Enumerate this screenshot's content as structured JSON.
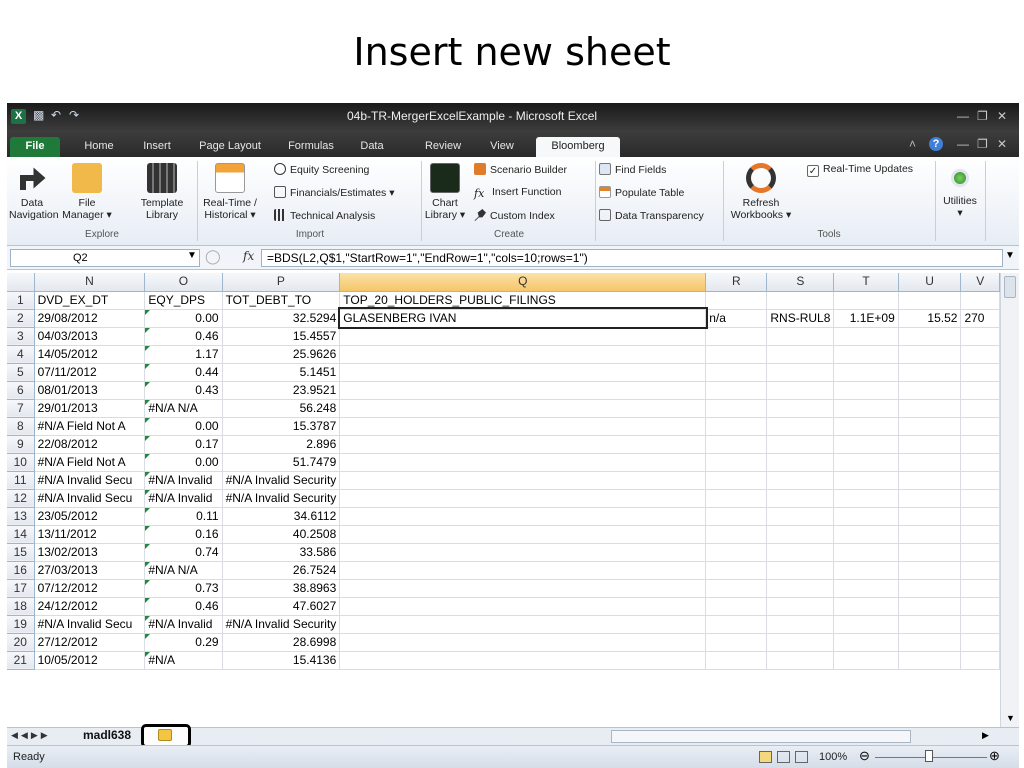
{
  "slide": {
    "title": "Insert new sheet"
  },
  "window": {
    "title": "04b-TR-MergerExcelExample  -  Microsoft Excel",
    "quick_access": [
      "save-icon",
      "undo-icon",
      "redo-icon"
    ]
  },
  "tabs": [
    "File",
    "Home",
    "Insert",
    "Page Layout",
    "Formulas",
    "Data",
    "Review",
    "View",
    "Bloomberg"
  ],
  "active_tab": "Bloomberg",
  "ribbon": {
    "data_navigation": [
      "Data",
      "Navigation"
    ],
    "file_manager": [
      "File",
      "Manager ▾"
    ],
    "template_library": [
      "Template",
      "Library"
    ],
    "explore_label": "Explore",
    "realtime_historical": [
      "Real-Time /",
      "Historical ▾"
    ],
    "equity_screening": "Equity Screening",
    "financials_estimates": "Financials/Estimates ▾",
    "technical_analysis": "Technical Analysis",
    "import_label": "Import",
    "chart_library": [
      "Chart",
      "Library ▾"
    ],
    "scenario_builder": "Scenario Builder",
    "insert_function": "Insert Function",
    "custom_index": "Custom Index",
    "create_label": "Create",
    "find_fields": "Find Fields",
    "populate_table": "Populate Table",
    "data_transparency": "Data Transparency",
    "refresh_workbooks": [
      "Refresh",
      "Workbooks ▾"
    ],
    "realtime_updates": "Real-Time Updates",
    "tools_label": "Tools",
    "utilities": "Utilities"
  },
  "formula_bar": {
    "name_box": "Q2",
    "fx": "fx",
    "formula": "=BDS(L2,Q$1,\"StartRow=1\",\"EndRow=1\",\"cols=10;rows=1\")"
  },
  "columns": [
    "N",
    "O",
    "P",
    "Q",
    "R",
    "S",
    "T",
    "U",
    "V"
  ],
  "rows": [
    {
      "r": "1",
      "N": "DVD_EX_DT",
      "O": "EQY_DPS",
      "P": "TOT_DEBT_TO",
      "Q": "TOP_20_HOLDERS_PUBLIC_FILINGS",
      "R": "",
      "S": "",
      "T": "",
      "U": "",
      "V": ""
    },
    {
      "r": "2",
      "N": "29/08/2012",
      "O": "0.00",
      "P": "32.5294",
      "Q": "GLASENBERG IVAN",
      "R": "n/a",
      "S": "RNS-RUL8",
      "T": "1.1E+09",
      "U": "15.52",
      "V": "270"
    },
    {
      "r": "3",
      "N": "04/03/2013",
      "O": "0.46",
      "P": "15.4557",
      "Q": "",
      "R": "",
      "S": "",
      "T": "",
      "U": "",
      "V": ""
    },
    {
      "r": "4",
      "N": "14/05/2012",
      "O": "1.17",
      "P": "25.9626",
      "Q": "",
      "R": "",
      "S": "",
      "T": "",
      "U": "",
      "V": ""
    },
    {
      "r": "5",
      "N": "07/11/2012",
      "O": "0.44",
      "P": "5.1451",
      "Q": "",
      "R": "",
      "S": "",
      "T": "",
      "U": "",
      "V": ""
    },
    {
      "r": "6",
      "N": "08/01/2013",
      "O": "0.43",
      "P": "23.9521",
      "Q": "",
      "R": "",
      "S": "",
      "T": "",
      "U": "",
      "V": ""
    },
    {
      "r": "7",
      "N": "29/01/2013",
      "O": "#N/A N/A",
      "P": "56.248",
      "Q": "",
      "R": "",
      "S": "",
      "T": "",
      "U": "",
      "V": ""
    },
    {
      "r": "8",
      "N": "#N/A Field Not A",
      "O": "0.00",
      "P": "15.3787",
      "Q": "",
      "R": "",
      "S": "",
      "T": "",
      "U": "",
      "V": ""
    },
    {
      "r": "9",
      "N": "22/08/2012",
      "O": "0.17",
      "P": "2.896",
      "Q": "",
      "R": "",
      "S": "",
      "T": "",
      "U": "",
      "V": ""
    },
    {
      "r": "10",
      "N": "#N/A Field Not A",
      "O": "0.00",
      "P": "51.7479",
      "Q": "",
      "R": "",
      "S": "",
      "T": "",
      "U": "",
      "V": ""
    },
    {
      "r": "11",
      "N": "#N/A Invalid Secu",
      "O": "#N/A Invalid",
      "P": "#N/A Invalid Security",
      "Q": "",
      "R": "",
      "S": "",
      "T": "",
      "U": "",
      "V": ""
    },
    {
      "r": "12",
      "N": "#N/A Invalid Secu",
      "O": "#N/A Invalid",
      "P": "#N/A Invalid Security",
      "Q": "",
      "R": "",
      "S": "",
      "T": "",
      "U": "",
      "V": ""
    },
    {
      "r": "13",
      "N": "23/05/2012",
      "O": "0.11",
      "P": "34.6112",
      "Q": "",
      "R": "",
      "S": "",
      "T": "",
      "U": "",
      "V": ""
    },
    {
      "r": "14",
      "N": "13/11/2012",
      "O": "0.16",
      "P": "40.2508",
      "Q": "",
      "R": "",
      "S": "",
      "T": "",
      "U": "",
      "V": ""
    },
    {
      "r": "15",
      "N": "13/02/2013",
      "O": "0.74",
      "P": "33.586",
      "Q": "",
      "R": "",
      "S": "",
      "T": "",
      "U": "",
      "V": ""
    },
    {
      "r": "16",
      "N": "27/03/2013",
      "O": "#N/A N/A",
      "P": "26.7524",
      "Q": "",
      "R": "",
      "S": "",
      "T": "",
      "U": "",
      "V": ""
    },
    {
      "r": "17",
      "N": "07/12/2012",
      "O": "0.73",
      "P": "38.8963",
      "Q": "",
      "R": "",
      "S": "",
      "T": "",
      "U": "",
      "V": ""
    },
    {
      "r": "18",
      "N": "24/12/2012",
      "O": "0.46",
      "P": "47.6027",
      "Q": "",
      "R": "",
      "S": "",
      "T": "",
      "U": "",
      "V": ""
    },
    {
      "r": "19",
      "N": "#N/A Invalid Secu",
      "O": "#N/A Invalid",
      "P": "#N/A Invalid Security",
      "Q": "",
      "R": "",
      "S": "",
      "T": "",
      "U": "",
      "V": ""
    },
    {
      "r": "20",
      "N": "27/12/2012",
      "O": "0.29",
      "P": "28.6998",
      "Q": "",
      "R": "",
      "S": "",
      "T": "",
      "U": "",
      "V": ""
    },
    {
      "r": "21",
      "N": "10/05/2012",
      "O": "#N/A",
      "P": "15.4136",
      "Q": "",
      "R": "",
      "S": "",
      "T": "",
      "U": "",
      "V": ""
    }
  ],
  "sheet_tabs": {
    "active": "madl638",
    "new_sheet_icon": "insert-worksheet-icon"
  },
  "status": {
    "ready": "Ready",
    "zoom": "100%"
  }
}
